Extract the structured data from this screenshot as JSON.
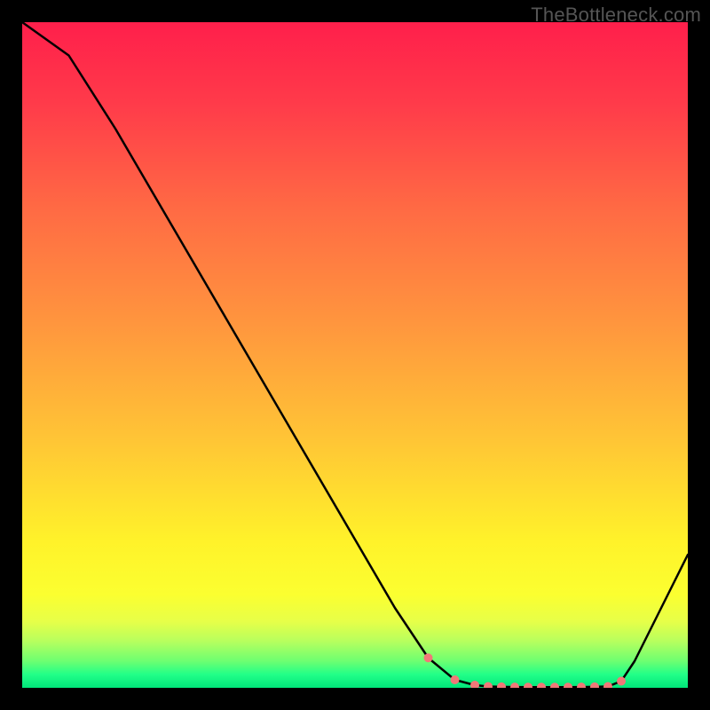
{
  "watermark": "TheBottleneck.com",
  "colors": {
    "marker": "#f07878",
    "line": "#000000"
  },
  "chart_data": {
    "type": "line",
    "title": "",
    "xlabel": "",
    "ylabel": "",
    "xlim": [
      0,
      100
    ],
    "ylim": [
      0,
      100
    ],
    "grid": false,
    "series": [
      {
        "name": "main-curve",
        "x": [
          0,
          7,
          14,
          21,
          28,
          35,
          42,
          49,
          56,
          61,
          65,
          68,
          70,
          72,
          74,
          76,
          78,
          80,
          82,
          84,
          86,
          88,
          90,
          92,
          94,
          96,
          98,
          100
        ],
        "values": [
          100,
          95,
          84,
          72,
          60,
          48,
          36,
          24,
          12,
          4.5,
          1.2,
          0.4,
          0.2,
          0.15,
          0.12,
          0.1,
          0.1,
          0.1,
          0.1,
          0.12,
          0.15,
          0.2,
          1.0,
          4.0,
          8.0,
          12.0,
          16.0,
          20.0
        ]
      }
    ],
    "markers": {
      "series": "main-curve",
      "indices": [
        9,
        10,
        11,
        12,
        13,
        14,
        15,
        16,
        17,
        18,
        19,
        20,
        21,
        22
      ],
      "radius": 5
    }
  }
}
